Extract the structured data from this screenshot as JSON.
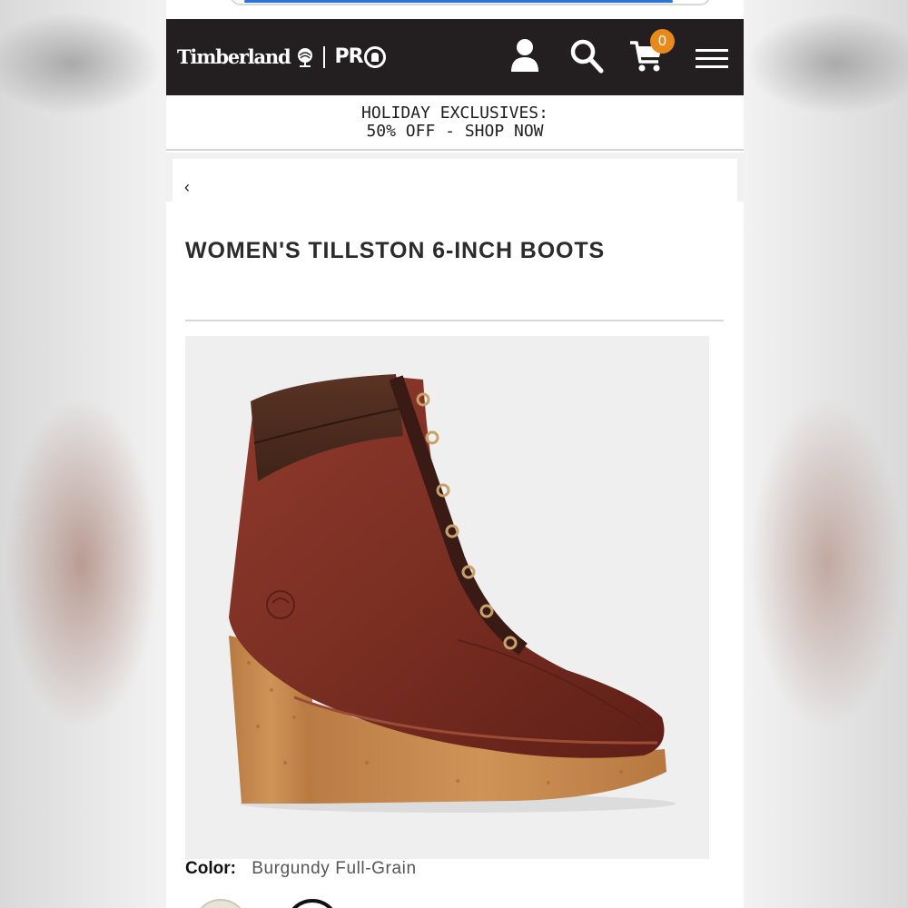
{
  "header": {
    "brand": "Timberland",
    "sub_brand": "PR",
    "cart_count": "0",
    "icons": [
      "user-icon",
      "search-icon",
      "cart-icon",
      "menu-icon"
    ],
    "background": "#231f20",
    "badge_color": "#e8891b"
  },
  "promo": {
    "line1": "HOLIDAY EXCLUSIVES:",
    "line2": "50% OFF - SHOP NOW"
  },
  "nav": {
    "back_label": "‹"
  },
  "product": {
    "title": "WOMEN'S TILLSTON 6-INCH BOOTS",
    "image_alt": "boot-photo",
    "color_label": "Color:",
    "color_value": "Burgundy Full-Grain"
  },
  "colors": {
    "leather": "#7a2e22",
    "sole": "#c98a4e"
  }
}
